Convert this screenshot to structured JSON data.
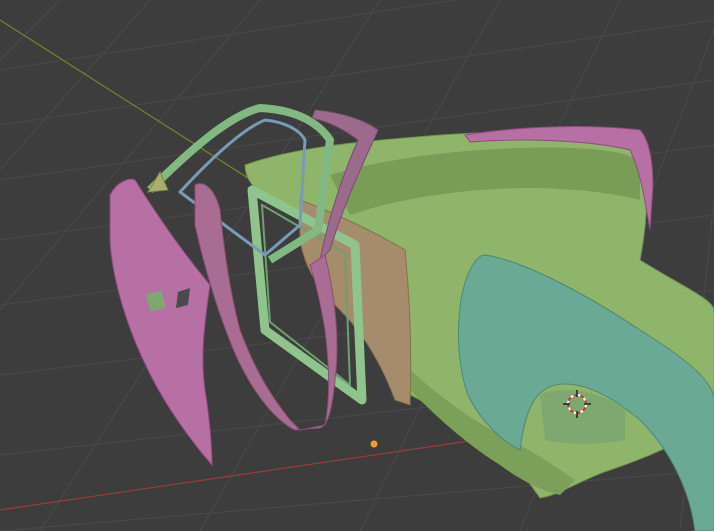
{
  "viewport": {
    "background_color": "#3d3d3d",
    "grid_color": "#4a4a4a",
    "x_axis_color": "#9c3b3b",
    "y_axis_color": "#6a8a2a",
    "origin_color": "#f0a030",
    "cursor_icon": "3d-cursor-icon"
  },
  "parts": [
    {
      "name": "car-body-shell",
      "color": "#8fb56a"
    },
    {
      "name": "rear-fender-panel",
      "color": "#6aaa94"
    },
    {
      "name": "door-outer-panel",
      "color": "#b670a4"
    },
    {
      "name": "door-inner-frame",
      "color": "#a96c92"
    },
    {
      "name": "window-frame-outer",
      "color": "#82b882"
    },
    {
      "name": "window-frame-inner",
      "color": "#7a9ab8"
    },
    {
      "name": "door-glass-channel",
      "color": "#8fc58c"
    },
    {
      "name": "door-trim-panel",
      "color": "#a58c6a"
    },
    {
      "name": "a-pillar-trim",
      "color": "#9c6a8c"
    }
  ]
}
